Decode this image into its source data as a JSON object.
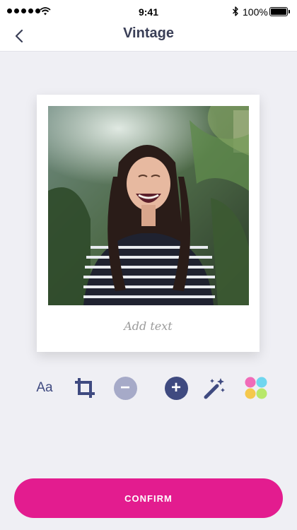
{
  "status_bar": {
    "time": "9:41",
    "battery": "100%",
    "signal_dots": 5
  },
  "nav": {
    "title": "Vintage",
    "back_icon": "chevron-left-icon"
  },
  "photo_card": {
    "caption_placeholder": "Add text"
  },
  "toolbar": {
    "text_tool_label": "Aa",
    "crop_icon": "crop-icon",
    "minus_symbol": "−",
    "plus_symbol": "+",
    "wand_icon": "magic-wand-icon",
    "palette_icon": "color-palette-icon"
  },
  "confirm": {
    "label": "CONFIRM"
  },
  "colors": {
    "accent": "#e31c8f",
    "icon": "#3f4a80",
    "title": "#3a3f57",
    "minus_bg": "#a6aac8",
    "plus_bg": "#3f4a80",
    "palette": [
      "#f06bb8",
      "#6fd6ef",
      "#f5c84c",
      "#b8e86a"
    ]
  }
}
